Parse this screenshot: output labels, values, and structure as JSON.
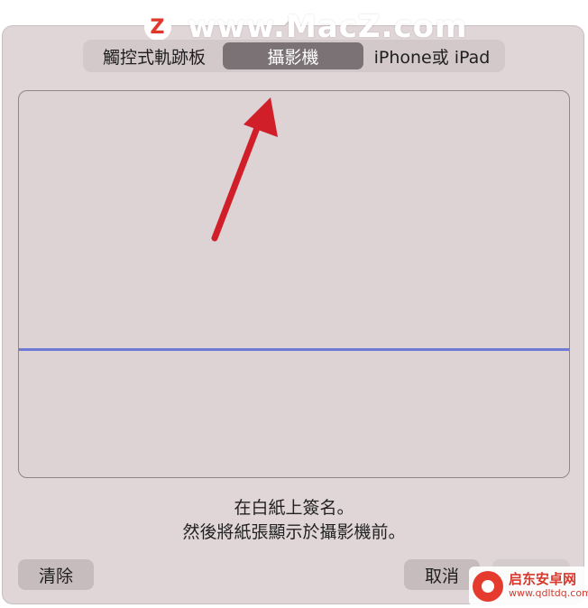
{
  "watermark": {
    "logo_letter": "Z",
    "text": "www.MacZ.com"
  },
  "tabs": [
    {
      "label": "觸控式軌跡板",
      "selected": false
    },
    {
      "label": "攝影機",
      "selected": true
    },
    {
      "label": "iPhone或 iPad",
      "selected": false
    }
  ],
  "instructions": {
    "line1": "在白紙上簽名。",
    "line2": "然後將紙張顯示於攝影機前。"
  },
  "buttons": {
    "clear": "清除",
    "cancel": "取消"
  },
  "corner_watermark": {
    "title": "启东安卓网",
    "url": "www.qdltdq.com"
  },
  "colors": {
    "baseline": "#6f7ad6",
    "arrow": "#d11f2a",
    "selected_tab": "#7a7275"
  }
}
